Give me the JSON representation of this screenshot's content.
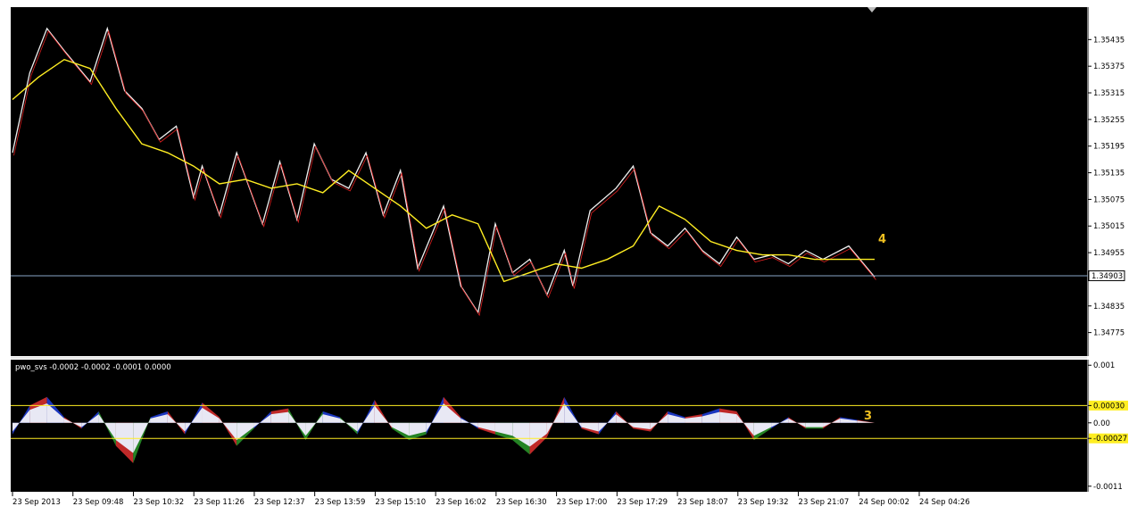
{
  "chart_data": [
    {
      "type": "line",
      "panel": "price",
      "ylim": [
        1.3473,
        1.355
      ],
      "y_ticks": [
        "1.35435",
        "1.35375",
        "1.35315",
        "1.35255",
        "1.35195",
        "1.35135",
        "1.35075",
        "1.35015",
        "1.34955",
        "1.34835",
        "1.34775"
      ],
      "y_tick_values": [
        1.35435,
        1.35375,
        1.35315,
        1.35255,
        1.35195,
        1.35135,
        1.35075,
        1.35015,
        1.34955,
        1.34835,
        1.34775
      ],
      "current_price_label": "1.34903",
      "current_price": 1.34903,
      "annotation_label": "4",
      "x_ticks": [
        "23 Sep 2013",
        "23 Sep 09:48",
        "23 Sep 10:32",
        "23 Sep 11:26",
        "23 Sep 12:37",
        "23 Sep 13:59",
        "23 Sep 15:10",
        "23 Sep 16:02",
        "23 Sep 16:30",
        "23 Sep 17:00",
        "23 Sep 17:29",
        "23 Sep 18:07",
        "23 Sep 19:32",
        "23 Sep 21:07",
        "24 Sep 00:02",
        "24 Sep 04:26"
      ],
      "price_series": {
        "x": [
          0,
          2,
          4,
          6,
          9,
          11,
          13,
          15,
          17,
          19,
          21,
          22,
          24,
          26,
          29,
          31,
          33,
          35,
          37,
          39,
          41,
          43,
          45,
          47,
          50,
          52,
          54,
          56,
          58,
          60,
          62,
          64,
          65,
          67,
          70,
          72,
          74,
          76,
          78,
          80,
          82,
          84,
          86,
          88,
          90,
          92,
          94,
          97,
          100
        ],
        "values": [
          1.3518,
          1.3536,
          1.3546,
          1.3541,
          1.3534,
          1.3546,
          1.3532,
          1.3528,
          1.3521,
          1.3524,
          1.3508,
          1.3515,
          1.3504,
          1.3518,
          1.3502,
          1.3516,
          1.3503,
          1.352,
          1.3512,
          1.351,
          1.3518,
          1.3504,
          1.3514,
          1.3492,
          1.3506,
          1.3488,
          1.3482,
          1.3502,
          1.3491,
          1.3494,
          1.3486,
          1.3496,
          1.3488,
          1.3505,
          1.351,
          1.3515,
          1.35,
          1.3497,
          1.3501,
          1.3496,
          1.3493,
          1.3499,
          1.3494,
          1.3495,
          1.3493,
          1.3496,
          1.3494,
          1.3497,
          1.349
        ]
      },
      "ma_series": {
        "x": [
          0,
          3,
          6,
          9,
          12,
          15,
          18,
          21,
          24,
          27,
          30,
          33,
          36,
          39,
          42,
          45,
          48,
          51,
          54,
          57,
          60,
          63,
          66,
          69,
          72,
          75,
          78,
          81,
          84,
          87,
          90,
          93,
          96,
          100
        ],
        "values": [
          1.353,
          1.3535,
          1.3539,
          1.3537,
          1.3528,
          1.352,
          1.3518,
          1.3515,
          1.3511,
          1.3512,
          1.351,
          1.3511,
          1.3509,
          1.3514,
          1.351,
          1.3506,
          1.3501,
          1.3504,
          1.3502,
          1.3489,
          1.3491,
          1.3493,
          1.3492,
          1.3494,
          1.3497,
          1.3506,
          1.3503,
          1.3498,
          1.3496,
          1.3495,
          1.3495,
          1.3494,
          1.3494,
          1.3494
        ]
      }
    },
    {
      "type": "area",
      "panel": "indicator",
      "title": "pwo_svs -0.0002 -0.0002 -0.0001 0.0000",
      "ylim": [
        -0.00115,
        0.00105
      ],
      "y_ticks": [
        "0.001",
        "0.00030",
        "0.00",
        "-0.00027",
        "-0.0011"
      ],
      "y_tick_values": [
        0.001,
        0.0003,
        0.0,
        -0.00027,
        -0.0011
      ],
      "levels": [
        0.0003,
        -0.00027
      ],
      "annotation_label": "3",
      "series": [
        {
          "x": [
            0,
            2,
            4,
            6,
            8,
            10,
            12,
            14,
            16,
            18,
            20,
            22,
            24,
            26,
            28,
            30,
            32,
            34,
            36,
            38,
            40,
            42,
            44,
            46,
            48,
            50,
            52,
            54,
            56,
            58,
            60,
            62,
            64,
            66,
            68,
            70,
            72,
            74,
            76,
            78,
            80,
            82,
            84,
            86,
            88,
            90,
            92,
            94,
            96,
            98,
            100
          ],
          "values": [
            -0.0002,
            0.0003,
            0.00045,
            0.0001,
            -0.0001,
            0.0002,
            -0.0004,
            -0.0007,
            0.0001,
            0.0002,
            -0.0002,
            0.00035,
            0.0001,
            -0.0004,
            -0.0001,
            0.0002,
            0.00025,
            -0.0003,
            0.0002,
            0.0001,
            -0.0002,
            0.0004,
            -0.0001,
            -0.0003,
            -0.0002,
            0.00045,
            0.0001,
            -0.0001,
            -0.0002,
            -0.0003,
            -0.00055,
            -0.00025,
            0.00045,
            -0.0001,
            -0.0002,
            0.0002,
            -0.0001,
            -0.00015,
            0.0002,
            0.0001,
            0.00015,
            0.00025,
            0.0002,
            -0.0003,
            -0.0001,
            0.0001,
            -0.0001,
            -0.0001,
            0.0001,
            5e-05,
            0.0
          ]
        }
      ]
    }
  ]
}
